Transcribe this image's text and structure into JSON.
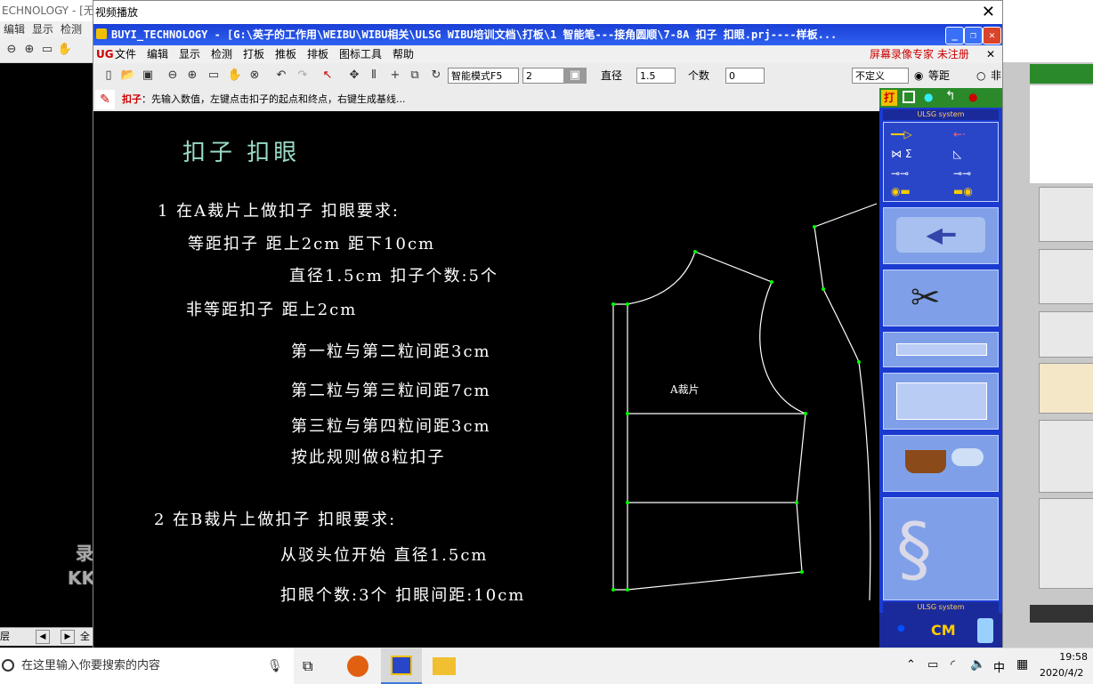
{
  "background_app": {
    "title": "ECHNOLOGY - [无",
    "menu": [
      "编辑",
      "显示",
      "检测"
    ],
    "status_left": "层",
    "status_right": "全"
  },
  "watermark": {
    "line1": "录制工具",
    "line2": "KK 录像机"
  },
  "video_window": {
    "title": "视频播放",
    "close": "✕"
  },
  "app_title": "BUYI_TECHNOLOGY - [G:\\英子的工作用\\WEIBU\\WIBU相关\\ULSG WIBU培训文档\\打板\\1 智能笔---接角圆顺\\7-8A 扣子 扣眼.prj----样板...",
  "menu": {
    "ug": "UG",
    "items": [
      "文件",
      "编辑",
      "显示",
      "检测",
      "打板",
      "推板",
      "排板",
      "图标工具",
      "帮助"
    ],
    "right": "屏幕录像专家 未注册",
    "close": "✕"
  },
  "toolbar": {
    "mode": "智能模式F5",
    "mode_value": "2",
    "diameter_label": "直径",
    "diameter_value": "1.5",
    "count_label": "个数",
    "count_value": "0",
    "undefined_select": "不定义",
    "equal_distance": "等距",
    "non_equal": "非"
  },
  "prompt": {
    "keyword": "扣子",
    "text": "：先输入数值，左键点击扣子的起点和终点，右键生成基线..."
  },
  "canvas": {
    "heading": "扣子  扣眼",
    "lines": [
      "1  在A裁片上做扣子  扣眼要求:",
      "等距扣子   距上2cm   距下10cm",
      "直径1.5cm   扣子个数:5个",
      "非等距扣子   距上2cm",
      "第一粒与第二粒间距3cm",
      "第二粒与第三粒间距7cm",
      "第三粒与第四粒间距3cm",
      "按此规则做8粒扣子",
      "2  在B裁片上做扣子  扣眼要求:",
      "从驳头位开始   直径1.5cm",
      "扣眼个数:3个   扣眼间距:10cm"
    ],
    "piece_label": "A裁片"
  },
  "tool_panel": {
    "header_top": "ULSG system",
    "header_bottom": "ULSG system",
    "cm": "CM"
  },
  "taskbar": {
    "search_placeholder": "在这里输入你要搜索的内容",
    "ime": "中",
    "time": "19:58",
    "date": "2020/4/2"
  },
  "colors": {
    "title_blue": "#1a3fd6",
    "panel_blue": "#1a3ad0",
    "canvas_bg": "#000000",
    "drawing_line": "#ffffff",
    "point_green": "#00ff00"
  }
}
